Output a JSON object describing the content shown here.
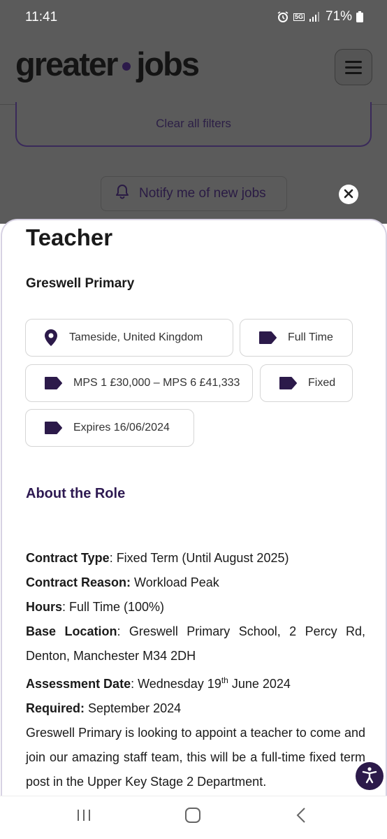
{
  "status_bar": {
    "time": "11:41",
    "network": "5G",
    "battery": "71%"
  },
  "header": {
    "logo_left": "greater",
    "logo_right": "jobs",
    "brand_color": "#2c1a4a"
  },
  "filters": {
    "clear_label": "Clear all filters",
    "notify_label": "Notify me of new jobs"
  },
  "job": {
    "title": "Teacher",
    "company": "Greswell Primary",
    "chips": {
      "location": "Tameside, United Kingdom",
      "type": "Full Time",
      "salary": "MPS 1 £30,000 – MPS 6 £41,333",
      "term": "Fixed",
      "expires": "Expires 16/06/2024"
    },
    "about_heading": "About the Role",
    "details": {
      "contract_type_label": "Contract Type",
      "contract_type_value": ": Fixed Term (Until August 2025)",
      "contract_reason_label": "Contract Reason:",
      "contract_reason_value": " Workload Peak",
      "hours_label": "Hours",
      "hours_value": ": Full Time (100%)",
      "base_location_label": "Base Location",
      "base_location_value": ": Greswell Primary School, 2 Percy Rd, Denton, Manchester M34 2DH",
      "assessment_label": "Assessment Date",
      "assessment_value_prefix": ": Wednesday 19",
      "assessment_value_sup": "th",
      "assessment_value_suffix": " June 2024",
      "required_label": "Required:",
      "required_value": " September 2024"
    },
    "paragraph": "Greswell Primary is looking to appoint a teacher to come and join our amazing staff team, this will be a full-time fixed term post in the Upper Key Stage 2 Department."
  },
  "icons": {
    "location": "map-pin-icon",
    "tag": "tag-icon",
    "bell": "bell-icon",
    "close": "close-icon",
    "menu": "hamburger-icon",
    "accessibility": "accessibility-icon"
  }
}
